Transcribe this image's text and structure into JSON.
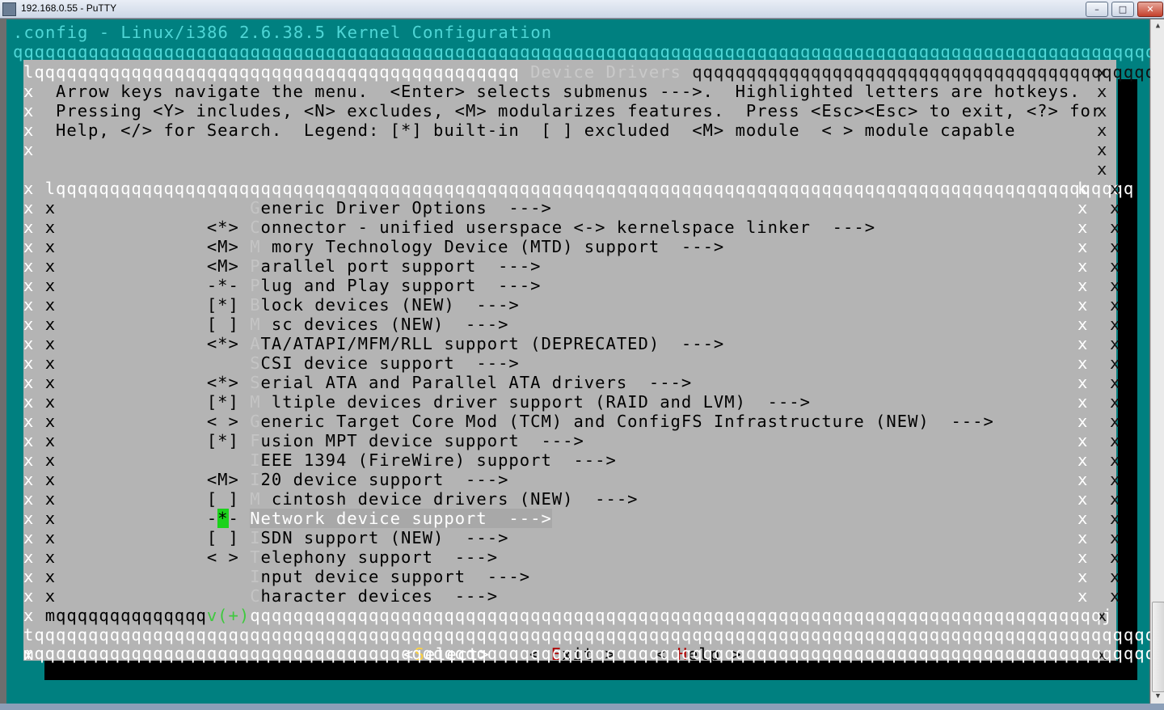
{
  "window": {
    "title": "192.168.0.55 - PuTTY",
    "min_label": "–",
    "max_label": "□",
    "close_label": "✕"
  },
  "terminal": {
    "header_title": ".config - Linux/i386 2.6.38.5 Kernel Configuration",
    "header_rule": "qqqqqqqqqqqqqqqqqqqqqqqqqqqqqqqqqqqqqqqqqqqqqqqqqqqqqqqqqqqqqqqqqqqqqqqqqqqqqqqqqqqqqqqqqqqqqqqqqqqqqqqqqqq",
    "dialog_top_left": "lqqqqqqqqqqqqqqqqqqqqqqqqqqqqqqqqqqqqqqqqqqqqq",
    "dialog_title": " Device Drivers ",
    "dialog_top_right": "qqqqqqqqqqqqqqqqqqqqqqqqqqqqqqqqqqqqqqqqqqqqk",
    "help_lines": [
      "Arrow keys navigate the menu.  <Enter> selects submenus --->.  Highlighted letters are hotkeys.",
      "Pressing <Y> includes, <N> excludes, <M> modularizes features.  Press <Esc><Esc> to exit, <?> for",
      "Help, </> for Search.  Legend: [*] built-in  [ ] excluded  <M> module  < > module capable"
    ],
    "menu_box_top": "lqqqqqqqqqqqqqqqqqqqqqqqqqqqqqqqqqqqqqqqqqqqqqqqqqqqqqqqqqqqqqqqqqqqqqqqqqqqqqqqqqqqqqqqqqqqqqqqqqqqq",
    "menu_items": [
      {
        "prefix": "   ",
        "hotkey": "G",
        "label": "eneric Driver Options  --->"
      },
      {
        "prefix": "<*>",
        "hotkey": "C",
        "label": "onnector - unified userspace <-> kernelspace linker  --->"
      },
      {
        "prefix": "<M>",
        "hotkey": "M",
        "label": " mory Technology Device (MTD) support  --->"
      },
      {
        "prefix": "<M>",
        "hotkey": "P",
        "label": "arallel port support  --->"
      },
      {
        "prefix": "-*-",
        "hotkey": "P",
        "label": "lug and Play support  --->"
      },
      {
        "prefix": "[*]",
        "hotkey": "B",
        "label": "lock devices (NEW)  --->"
      },
      {
        "prefix": "[ ]",
        "hotkey": "M",
        "label": " sc devices (NEW)  --->"
      },
      {
        "prefix": "<*>",
        "hotkey": "A",
        "label": "TA/ATAPI/MFM/RLL support (DEPRECATED)  --->"
      },
      {
        "prefix": "   ",
        "hotkey": "S",
        "label": "CSI device support  --->"
      },
      {
        "prefix": "<*>",
        "hotkey": "S",
        "label": "erial ATA and Parallel ATA drivers  --->"
      },
      {
        "prefix": "[*]",
        "hotkey": "M",
        "label": " ltiple devices driver support (RAID and LVM)  --->"
      },
      {
        "prefix": "< >",
        "hotkey": "G",
        "label": "eneric Target Core Mod (TCM) and ConfigFS Infrastructure (NEW)  --->"
      },
      {
        "prefix": "[*]",
        "hotkey": "F",
        "label": "usion MPT device support  --->"
      },
      {
        "prefix": "   ",
        "hotkey": "I",
        "label": "EEE 1394 (FireWire) support  --->"
      },
      {
        "prefix": "<M>",
        "hotkey": "I",
        "label": "20 device support  --->"
      },
      {
        "prefix": "[ ]",
        "hotkey": "M",
        "label": " cintosh device drivers (NEW)  --->"
      },
      {
        "prefix": "-*-",
        "hotkey": "N",
        "label": "etwork device support  --->",
        "selected": true
      },
      {
        "prefix": "[ ]",
        "hotkey": "I",
        "label": "SDN support (NEW)  --->"
      },
      {
        "prefix": "< >",
        "hotkey": "T",
        "label": "elephony support  --->"
      },
      {
        "prefix": "   ",
        "hotkey": "I",
        "label": "nput device support  --->"
      },
      {
        "prefix": "   ",
        "hotkey": "C",
        "label": "haracter devices  --->"
      }
    ],
    "menu_box_bottom_left": "mqqqqqqqqqqqqqq",
    "menu_box_more": "v(+)",
    "menu_box_bottom_right": "qqqqqqqqqqqqqqqqqqqqqqqqqqqqqqqqqqqqqqqqqqqqqqqqqqqqqqqqqqqqqqqqqqqqqqqqqqqqqqqj",
    "separator": "tqqqqqqqqqqqqqqqqqqqqqqqqqqqqqqqqqqqqqqqqqqqqqqqqqqqqqqqqqqqqqqqqqqqqqqqqqqqqqqqqqqqqqqqqqqqqqqqqqqqqqqqqqqu",
    "buttons": {
      "select": {
        "open": "<",
        "hot": "S",
        "rest": "elect",
        "close": ">"
      },
      "exit": {
        "open": "< ",
        "hot": "E",
        "rest": "xit",
        "close": " >"
      },
      "help": {
        "open": "< ",
        "hot": "H",
        "rest": "elp",
        "close": " >"
      }
    },
    "dialog_bottom": "mqqqqqqqqqqqqqqqqqqqqqqqqqqqqqqqqqqqqqqqqqqqqqqqqqqqqqqqqqqqqqqqqqqqqqqqqqqqqqqqqqqqqqqqqqqqqqqqqqqqqqqqqqqqqj",
    "edge_char": "x"
  }
}
